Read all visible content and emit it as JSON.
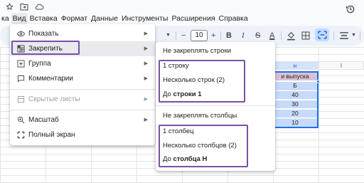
{
  "topbar": {
    "icons": [
      "star-icon",
      "folder-move-icon",
      "cloud-status-icon"
    ],
    "history_icon": "history-icon"
  },
  "menubar": {
    "items": [
      {
        "label": "ка"
      },
      {
        "label": "Вид"
      },
      {
        "label": "Вставка"
      },
      {
        "label": "Формат"
      },
      {
        "label": "Данные"
      },
      {
        "label": "Инструменты"
      },
      {
        "label": "Расширения"
      },
      {
        "label": "Справка"
      }
    ]
  },
  "toolbar": {
    "font_minus": "−",
    "font_size": "10",
    "font_plus": "+",
    "bold": "B",
    "italic": "I",
    "strike": "S",
    "text_color": "A"
  },
  "sheet": {
    "selected_column_header": "н",
    "other_column_header": "I",
    "header_cell": "и выпуска",
    "cells": [
      "Б",
      "40",
      "30",
      "20",
      "10"
    ]
  },
  "main_menu": {
    "items": [
      {
        "label": "Показать",
        "icon": "eye-icon",
        "has_submenu": true
      },
      {
        "label": "Закрепить",
        "icon": "freeze-grid-icon",
        "has_submenu": true
      },
      {
        "label": "Группа",
        "icon": "group-plus-icon",
        "has_submenu": true
      },
      {
        "label": "Комментарии",
        "icon": "comment-icon",
        "has_submenu": true
      },
      {
        "label": "Скрытые листы",
        "icon": "hidden-sheets-icon",
        "has_submenu": true,
        "disabled": true
      },
      {
        "label": "Масштаб",
        "icon": "zoom-icon",
        "has_submenu": true
      },
      {
        "label": "Полный экран",
        "icon": "fullscreen-icon",
        "has_submenu": false
      }
    ]
  },
  "freeze_submenu": {
    "rows_none": "Не закреплять строки",
    "row_1": "1 строку",
    "rows_multi": "Несколько строк (2)",
    "rows_to_prefix": "До ",
    "rows_to_bold": "строки 1",
    "cols_none": "Не закреплять столбцы",
    "col_1": "1 столбец",
    "cols_multi": "Несколько столбцов (2)",
    "cols_to_prefix": "До ",
    "cols_to_bold": "столбца H"
  },
  "colors": {
    "highlight_border": "#7b4fa6",
    "selection_blue": "#1a73e8",
    "selected_cells": "#c6dafc"
  }
}
